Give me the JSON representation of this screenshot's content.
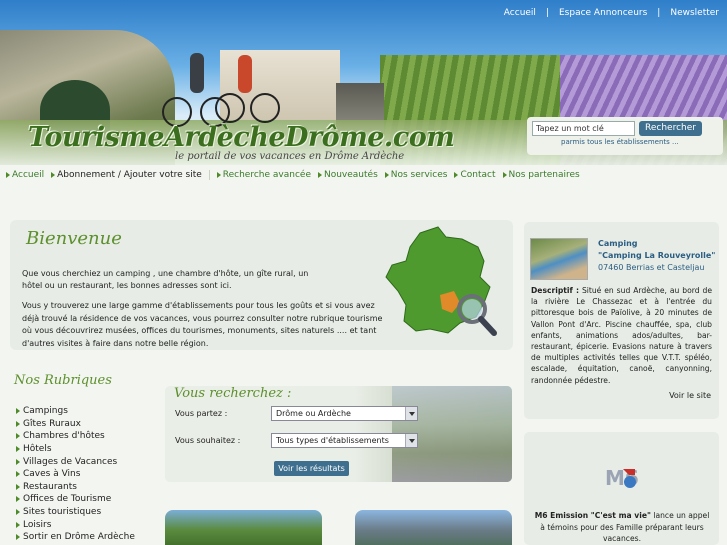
{
  "top_links": [
    "Accueil",
    "Espace Annonceurs",
    "Newsletter"
  ],
  "logo_text": "TourismeArdècheDrôme.com",
  "tagline": "le portail de vos vacances en Drôme Ardèche",
  "search": {
    "input_value": "Tapez un mot clé",
    "button_label": "Rechercher",
    "scope_label": "parmis tous les établissements ..."
  },
  "nav": [
    {
      "label": "Accueil",
      "active": false
    },
    {
      "label": "Abonnement / Ajouter votre site",
      "active": true
    },
    {
      "label": "Recherche avancée",
      "active": false
    },
    {
      "label": "Nouveautés",
      "active": false
    },
    {
      "label": "Nos services",
      "active": false
    },
    {
      "label": "Contact",
      "active": false
    },
    {
      "label": "Nos partenaires",
      "active": false
    }
  ],
  "welcome": {
    "title": "Bienvenue",
    "p1": "Que vous cherchiez un camping , une chambre d'hôte, un gîte rural, un hôtel ou un restaurant, les bonnes adresses sont ici.",
    "p2": "Vous y trouverez une large gamme d'établissements pour tous les goûts et si vous avez déjà trouvé la résidence de vos vacances, vous pourrez consulter notre rubrique tourisme où vous découvrirez musées, offices du tourismes, monuments, sites naturels .... et tant d'autres visites à faire dans notre belle région."
  },
  "rubriques": {
    "title": "Nos Rubriques",
    "items": [
      "Campings",
      "Gîtes Ruraux",
      "Chambres d'hôtes",
      "Hôtels",
      "Villages de Vacances",
      "Caves à Vins",
      "Restaurants",
      "Offices de Tourisme",
      "Sites touristiques",
      "Loisirs",
      "Sortir en Drôme Ardèche"
    ]
  },
  "recherche": {
    "title": "Vous recherchez :",
    "label_partez": "Vous partez :",
    "value_partez": "Drôme ou Ardèche",
    "label_souhaitez": "Vous souhaitez :",
    "value_souhaitez": "Tous types d'établissements",
    "button_label": "Voir les résultats"
  },
  "camping": {
    "type": "Camping",
    "name": "\"Camping La Rouveyrolle\"",
    "location": "07460 Berrias et Casteljau",
    "desc_label": "Descriptif :",
    "desc": "Situé en sud Ardèche, au bord de la rivière Le Chassezac et à l'entrée du pittoresque bois de Païolive, à 20 minutes de Vallon Pont d'Arc. Piscine chauffée, spa, club enfants, animations ados/adultes, bar-restaurant, épicerie. Evasions nature à travers de multiples activités telles que V.T.T. spéléo, escalade, équitation, canoë, canyonning, randonnée pédestre.",
    "more_label": "Voir le site"
  },
  "m6": {
    "logo_text": "M6",
    "bold_text": "M6 Emission \"C'est ma vie\"",
    "text": " lance un appel à témoins pour des Famille préparant leurs vacances."
  },
  "colors": {
    "accent_green": "#5d8f2c",
    "nav_green": "#3a7a2a",
    "button_blue": "#3e6f8e",
    "link_blue": "#2c5d83"
  }
}
